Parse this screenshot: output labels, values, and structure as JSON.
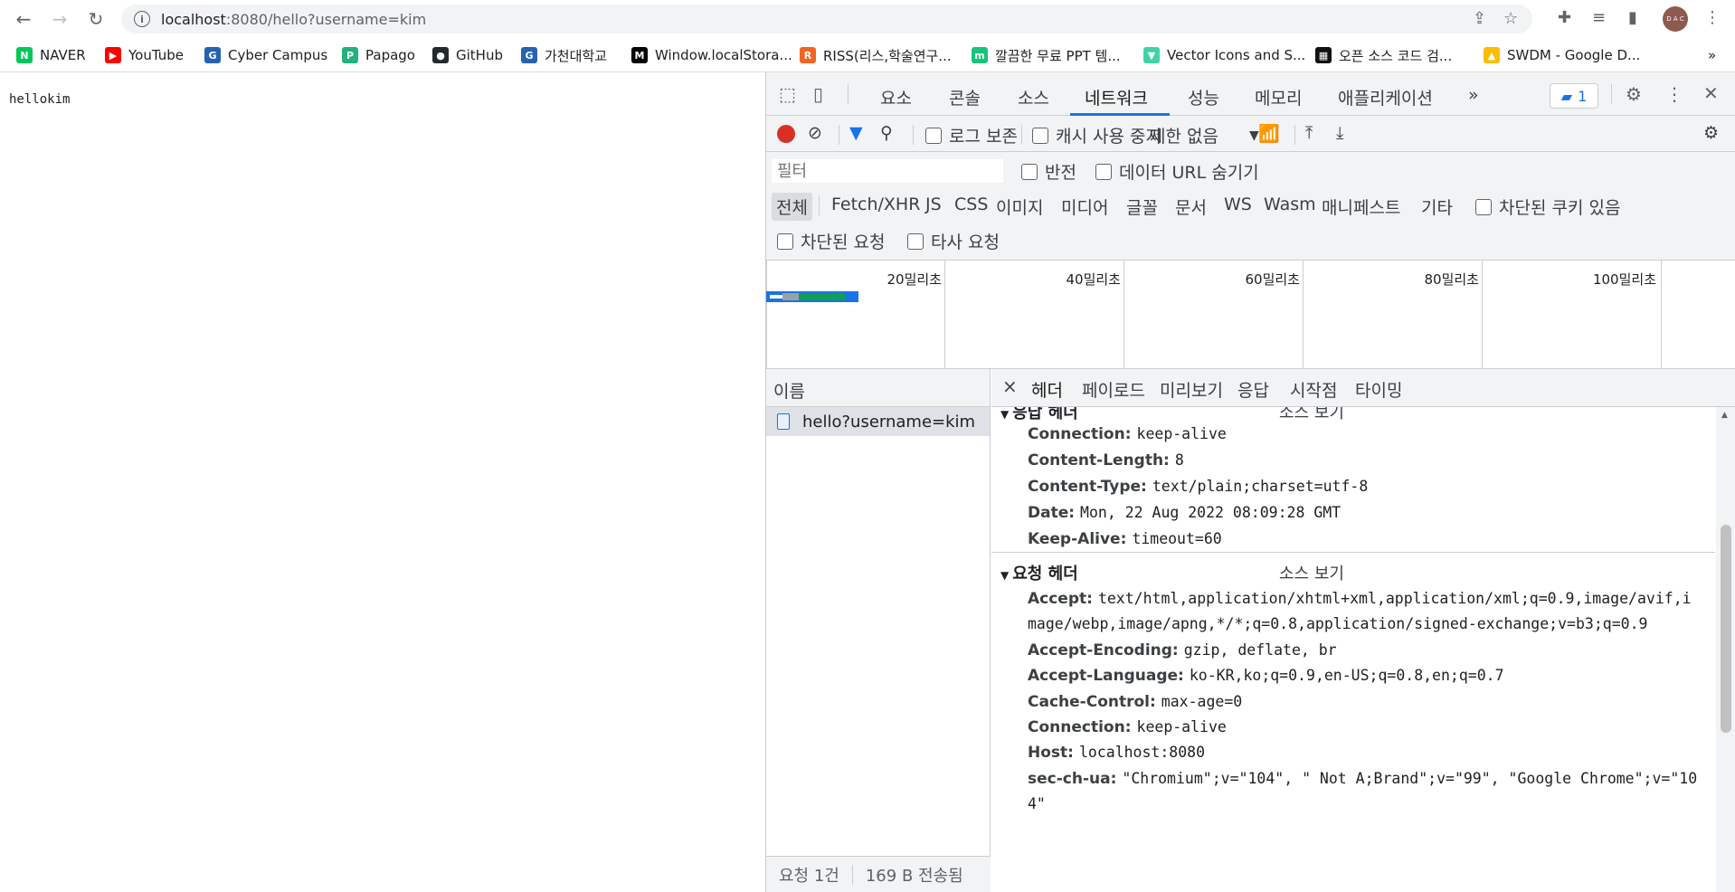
{
  "browser": {
    "url_host": "localhost",
    "url_path": ":8080/hello?username=kim",
    "avatar_text": "D A C",
    "bookmarks": [
      {
        "label": "NAVER",
        "color": "#03c75a",
        "glyph": "N"
      },
      {
        "label": "YouTube",
        "color": "#ff0000",
        "glyph": "▶"
      },
      {
        "label": "Cyber Campus",
        "color": "#2563b0",
        "glyph": "G"
      },
      {
        "label": "Papago",
        "color": "#23b17e",
        "glyph": "P"
      },
      {
        "label": "GitHub",
        "color": "#24292f",
        "glyph": "●"
      },
      {
        "label": "가천대학교",
        "color": "#2563b0",
        "glyph": "G"
      },
      {
        "label": "Window.localStora...",
        "color": "#000000",
        "glyph": "M"
      },
      {
        "label": "RISS(리스,학술연구...",
        "color": "#f26522",
        "glyph": "R"
      },
      {
        "label": "깔끔한 무료 PPT 템...",
        "color": "#19c37d",
        "glyph": "m"
      },
      {
        "label": "Vector Icons and S...",
        "color": "#3ed2a4",
        "glyph": "▼"
      },
      {
        "label": "오픈 소스 코드 검...",
        "color": "#111111",
        "glyph": "▦"
      },
      {
        "label": "SWDM - Google D...",
        "color": "#fbbc04",
        "glyph": "▲"
      }
    ],
    "more_bookmarks": "»"
  },
  "page": {
    "text": "hellokim"
  },
  "devtools": {
    "tabs": [
      "요소",
      "콘솔",
      "소스",
      "네트워크",
      "성능",
      "메모리",
      "애플리케이션"
    ],
    "more_tabs": "»",
    "issues_count": "1",
    "toolbar": {
      "preserve_log": "로그 보존",
      "disable_cache": "캐시 사용 중지",
      "throttle": "제한 없음"
    },
    "filter": {
      "placeholder": "필터",
      "invert": "반전",
      "hide_data_urls": "데이터 URL 숨기기",
      "types": [
        "전체",
        "Fetch/XHR",
        "JS",
        "CSS",
        "이미지",
        "미디어",
        "글꼴",
        "문서",
        "WS",
        "Wasm",
        "매니페스트",
        "기타"
      ],
      "blocked_cookies": "차단된 쿠키 있음",
      "blocked_requests": "차단된 요청",
      "third_party": "타사 요청"
    },
    "timeline_labels": [
      "20밀리초",
      "40밀리초",
      "60밀리초",
      "80밀리초",
      "100밀리초"
    ],
    "requests": {
      "header": "이름",
      "rows": [
        "hello?username=kim"
      ],
      "status_count": "요청 1건",
      "status_transfer": "169 B 전송됨"
    },
    "detail": {
      "close": "×",
      "tabs": [
        "헤더",
        "페이로드",
        "미리보기",
        "응답",
        "시작점",
        "타이밍"
      ],
      "response_section": "응답 헤더",
      "request_section": "요청 헤더",
      "view_source": "소스 보기",
      "response_headers": [
        {
          "k": "Connection:",
          "v": "keep-alive"
        },
        {
          "k": "Content-Length:",
          "v": "8"
        },
        {
          "k": "Content-Type:",
          "v": "text/plain;charset=utf-8"
        },
        {
          "k": "Date:",
          "v": "Mon, 22 Aug 2022 08:09:28 GMT"
        },
        {
          "k": "Keep-Alive:",
          "v": "timeout=60"
        }
      ],
      "request_headers": [
        {
          "k": "Accept:",
          "v": "text/html,application/xhtml+xml,application/xml;q=0.9,image/avif,i"
        },
        {
          "k": "",
          "v": "mage/webp,image/apng,*/*;q=0.8,application/signed-exchange;v=b3;q=0.9"
        },
        {
          "k": "Accept-Encoding:",
          "v": "gzip, deflate, br"
        },
        {
          "k": "Accept-Language:",
          "v": "ko-KR,ko;q=0.9,en-US;q=0.8,en;q=0.7"
        },
        {
          "k": "Cache-Control:",
          "v": "max-age=0"
        },
        {
          "k": "Connection:",
          "v": "keep-alive"
        },
        {
          "k": "Host:",
          "v": "localhost:8080"
        },
        {
          "k": "sec-ch-ua:",
          "v": "\"Chromium\";v=\"104\", \" Not A;Brand\";v=\"99\", \"Google Chrome\";v=\"10"
        },
        {
          "k": "",
          "v": "4\""
        }
      ]
    }
  }
}
